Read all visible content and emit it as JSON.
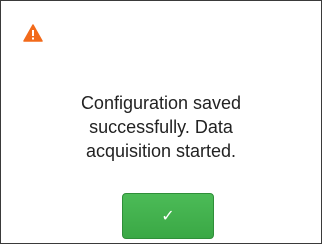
{
  "dialog": {
    "icon": "warning-triangle-icon",
    "icon_color": "#f26a1b",
    "message_lines": [
      "Configuration saved",
      "successfully. Data",
      "acquisition started."
    ],
    "confirm_button": {
      "icon": "checkmark-icon",
      "glyph": "✓",
      "color": "#43b24f"
    }
  }
}
